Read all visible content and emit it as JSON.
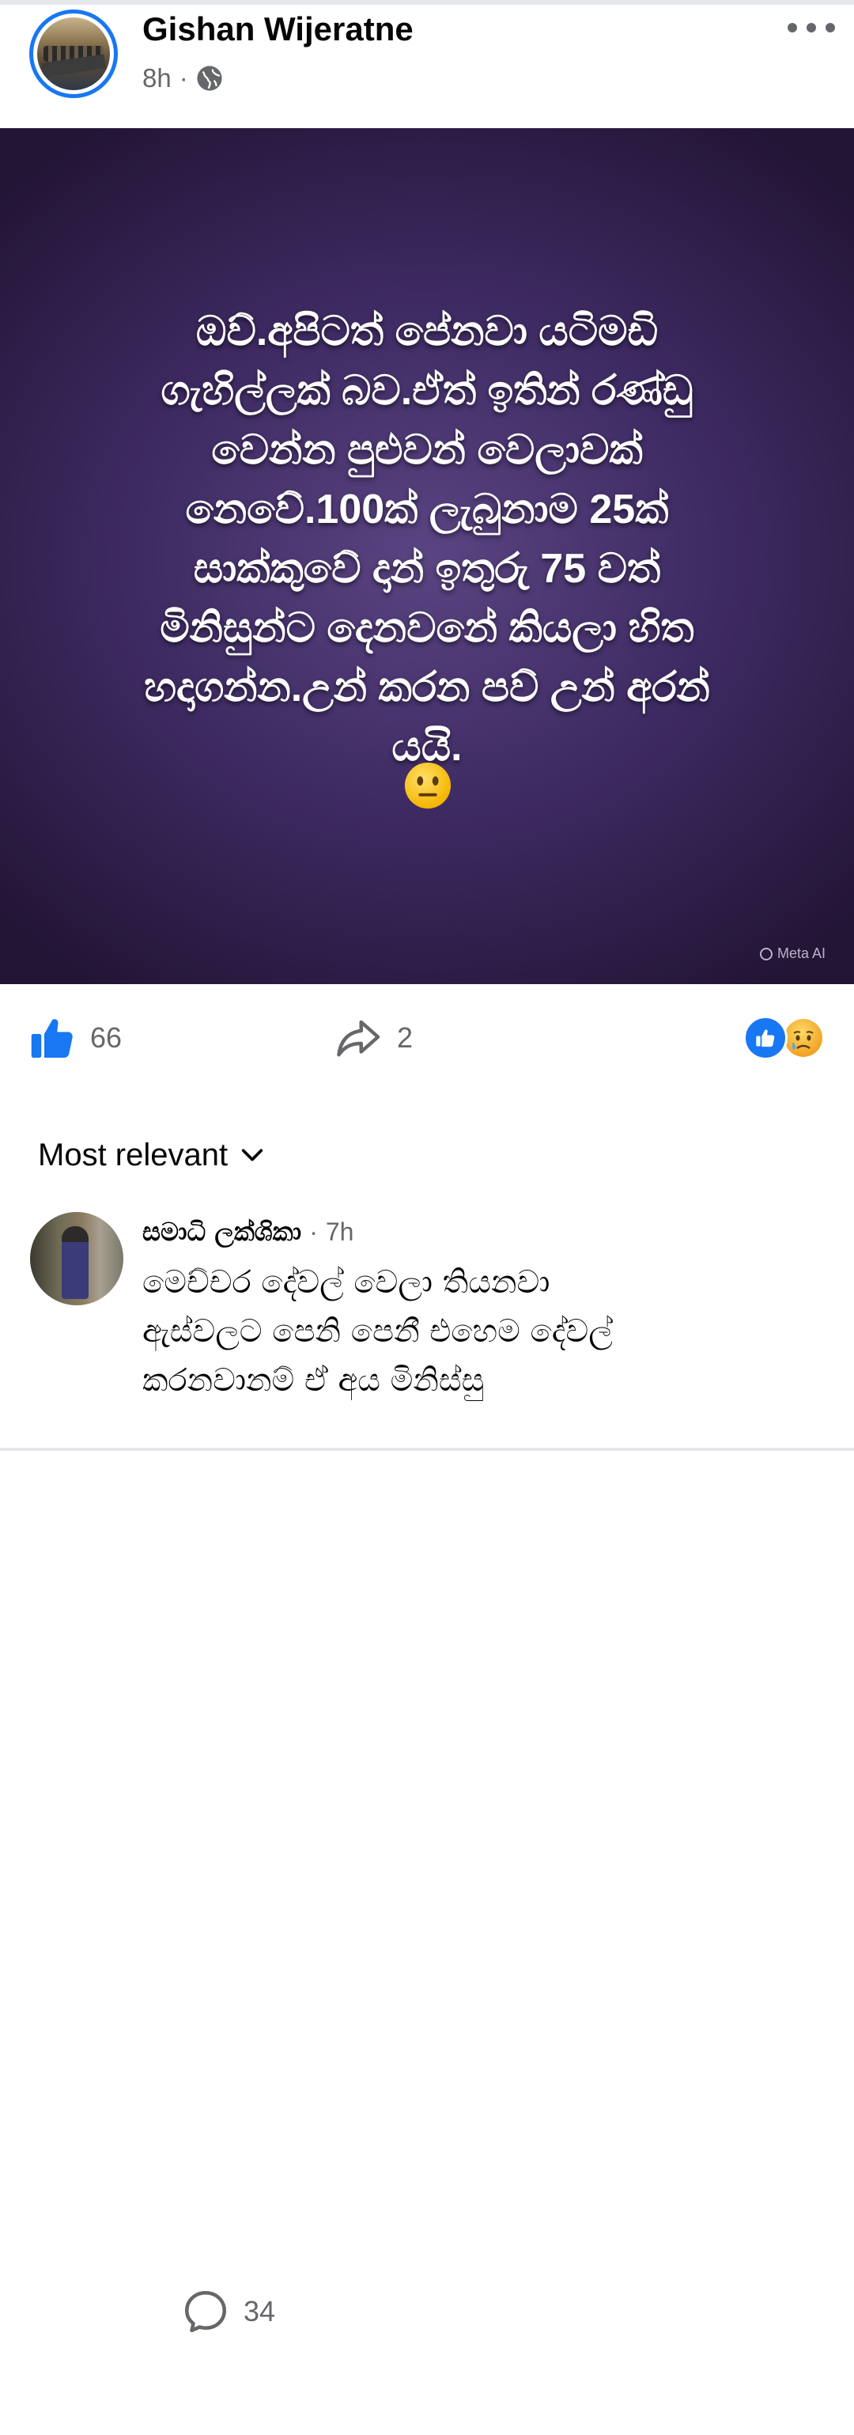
{
  "post": {
    "author": "Gishan Wijeratne",
    "time": "8h",
    "separator": "·",
    "privacy_icon": "globe-icon",
    "more_icon": "more-horizontal-icon",
    "image_text": "ඔව්.අපිටත් පේනවා යටිමඩි\nගැහිල්ලක් බව.ඒත් ඉතින් රණ්ඩු\nවෙන්න පුළුවන් වෙලාවක්\nනෙවේ.100ක් ලැබුනාම 25ක්\nසාක්කුවේ දාන් ඉතුරු 75 වත්\nමිනිසුන්ට දෙනවනේ කියලා හිත\nහදාගන්න.උන් කරන පව් උන් අරන්\nයයි.",
    "image_emoji": "neutral-face-emoji",
    "watermark": "Meta AI"
  },
  "actions": {
    "likes": "66",
    "comments": "34",
    "shares": "2",
    "reaction_icons": [
      "like-reaction-icon",
      "sad-reaction-icon"
    ]
  },
  "comments_section": {
    "sort_label": "Most relevant",
    "items": [
      {
        "author": "සමාධි ලක්ශිකා",
        "time": "7h",
        "separator": "·",
        "text": "මෙච්චර දේවල් වෙලා තියනවා\nඇස්වලට පෙනි පෙනී එහෙම දේවල්\nකරනවානම් ඒ අය මිනිස්සු"
      }
    ]
  },
  "colors": {
    "accent": "#1877f2",
    "secondary_text": "#65676b",
    "post_bg": "#3e2a62"
  }
}
